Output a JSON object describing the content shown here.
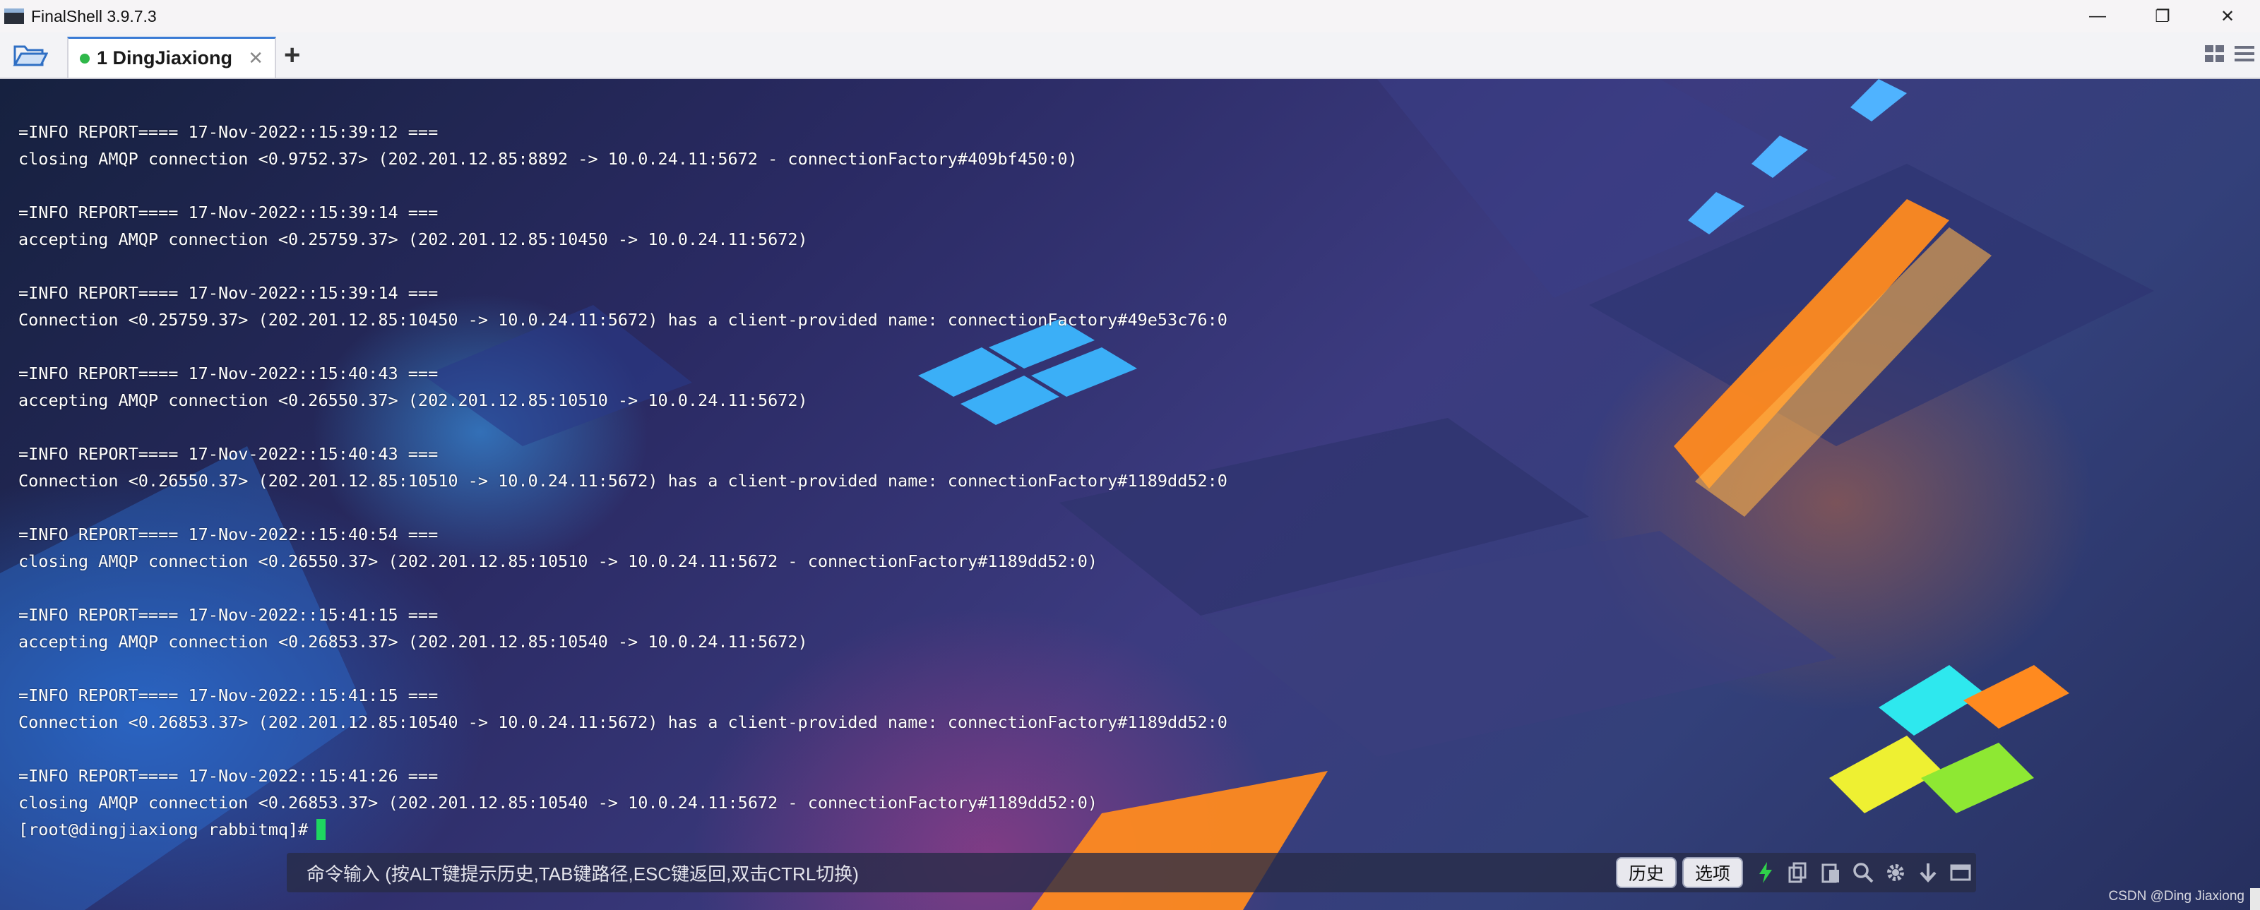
{
  "window": {
    "title": "FinalShell 3.9.7.3",
    "controls": [
      "—",
      "❐",
      "✕"
    ]
  },
  "tabs": [
    {
      "label": "1 DingJiaxiong",
      "close": "✕",
      "status_color": "#2fb84a"
    }
  ],
  "add_tab": "+",
  "terminal": {
    "lines": [
      "=INFO REPORT==== 17-Nov-2022::15:39:12 ===",
      "closing AMQP connection <0.9752.37> (202.201.12.85:8892 -> 10.0.24.11:5672 - connectionFactory#409bf450:0)",
      "",
      "=INFO REPORT==== 17-Nov-2022::15:39:14 ===",
      "accepting AMQP connection <0.25759.37> (202.201.12.85:10450 -> 10.0.24.11:5672)",
      "",
      "=INFO REPORT==== 17-Nov-2022::15:39:14 ===",
      "Connection <0.25759.37> (202.201.12.85:10450 -> 10.0.24.11:5672) has a client-provided name: connectionFactory#49e53c76:0",
      "",
      "=INFO REPORT==== 17-Nov-2022::15:40:43 ===",
      "accepting AMQP connection <0.26550.37> (202.201.12.85:10510 -> 10.0.24.11:5672)",
      "",
      "=INFO REPORT==== 17-Nov-2022::15:40:43 ===",
      "Connection <0.26550.37> (202.201.12.85:10510 -> 10.0.24.11:5672) has a client-provided name: connectionFactory#1189dd52:0",
      "",
      "=INFO REPORT==== 17-Nov-2022::15:40:54 ===",
      "closing AMQP connection <0.26550.37> (202.201.12.85:10510 -> 10.0.24.11:5672 - connectionFactory#1189dd52:0)",
      "",
      "=INFO REPORT==== 17-Nov-2022::15:41:15 ===",
      "accepting AMQP connection <0.26853.37> (202.201.12.85:10540 -> 10.0.24.11:5672)",
      "",
      "=INFO REPORT==== 17-Nov-2022::15:41:15 ===",
      "Connection <0.26853.37> (202.201.12.85:10540 -> 10.0.24.11:5672) has a client-provided name: connectionFactory#1189dd52:0",
      "",
      "=INFO REPORT==== 17-Nov-2022::15:41:26 ===",
      "closing AMQP connection <0.26853.37> (202.201.12.85:10540 -> 10.0.24.11:5672 - connectionFactory#1189dd52:0)"
    ],
    "prompt": "[root@dingjiaxiong rabbitmq]#",
    "cursor_color": "#1ed760"
  },
  "command_bar": {
    "placeholder": "命令输入 (按ALT键提示历史,TAB键路径,ESC键返回,双击CTRL切换)",
    "history_button": "历史",
    "options_button": "选项",
    "icons": [
      "lightning-icon",
      "copy-icon",
      "paste-icon",
      "search-icon",
      "gear-icon",
      "download-icon",
      "window-icon"
    ]
  },
  "watermark": "CSDN @Ding Jiaxiong",
  "colors": {
    "accent": "#3a7bd5",
    "terminal_text": "#ffffff"
  }
}
